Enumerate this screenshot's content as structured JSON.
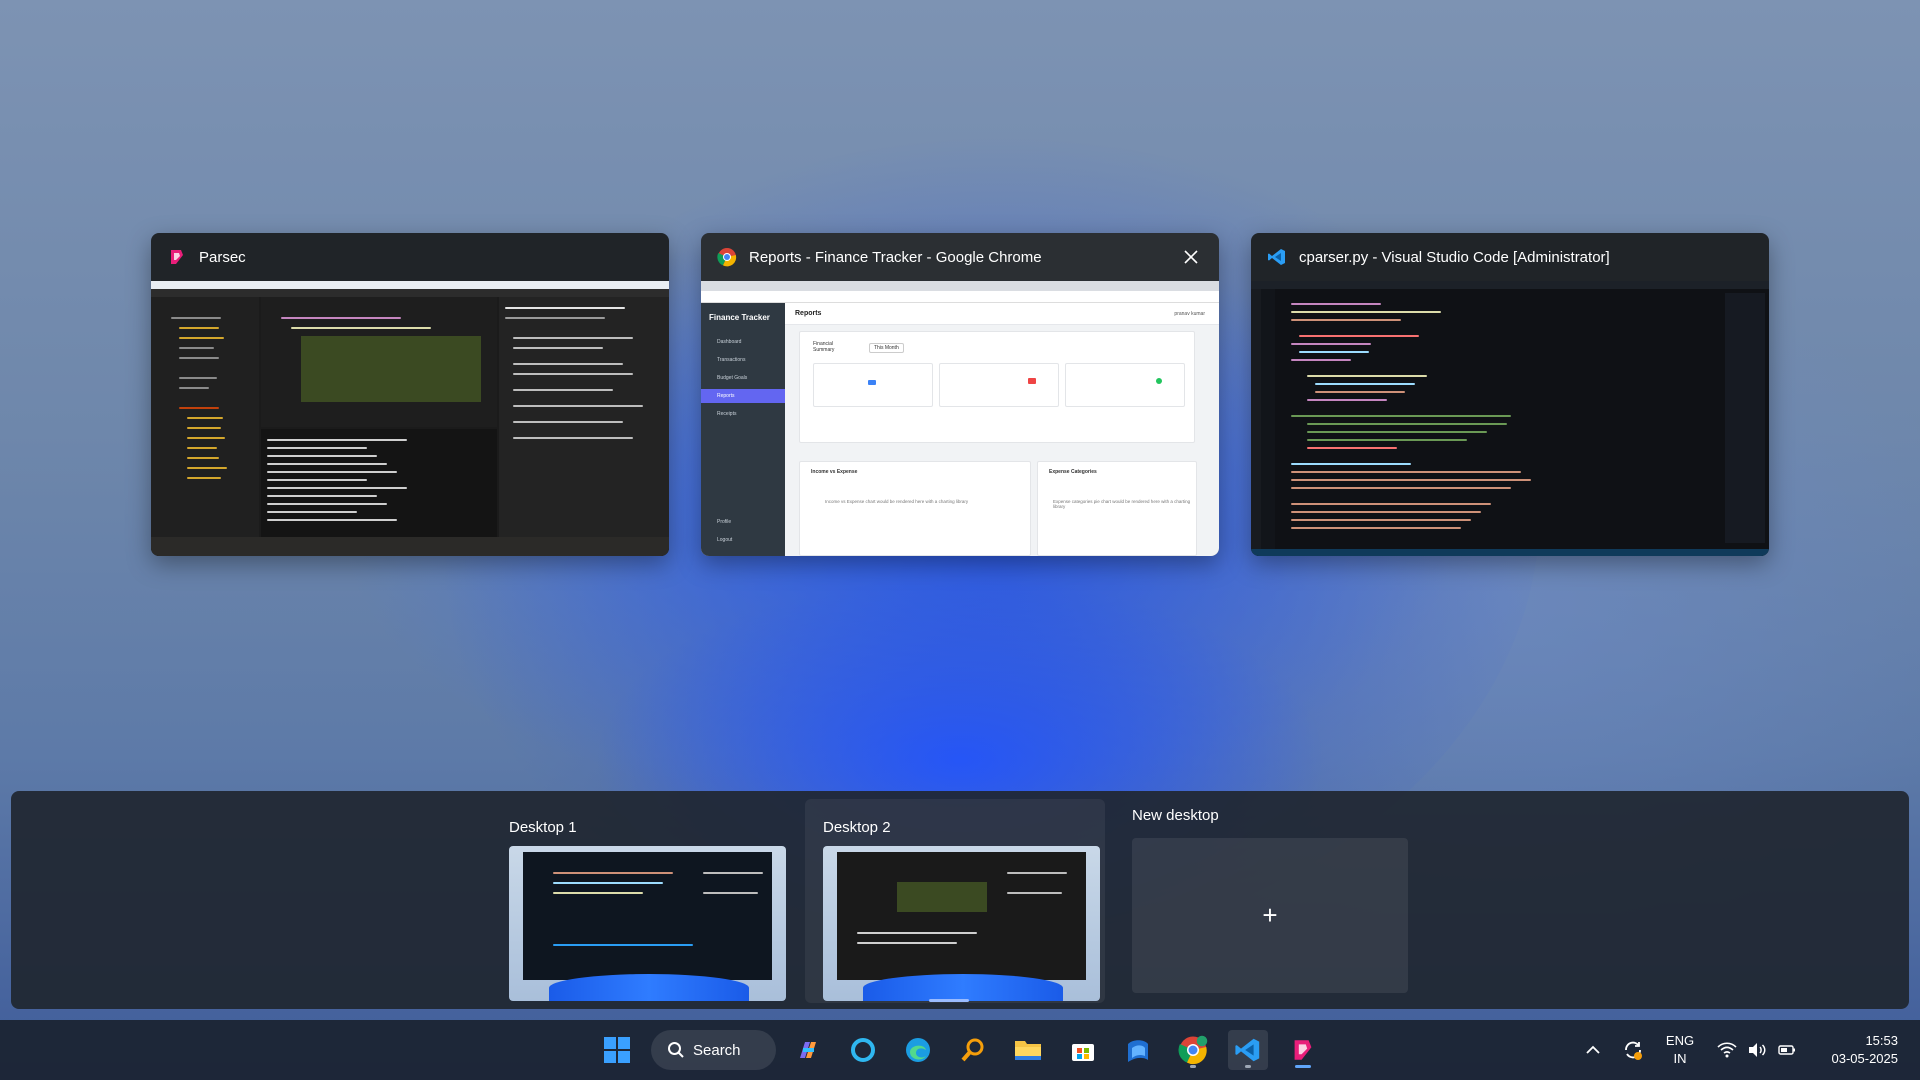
{
  "windows": [
    {
      "title": "Parsec",
      "icon": "parsec-icon"
    },
    {
      "title": "Reports - Finance Tracker - Google Chrome",
      "icon": "chrome-icon"
    },
    {
      "title": "cparser.py - Visual Studio Code [Administrator]",
      "icon": "vscode-icon"
    }
  ],
  "chrome_thumb": {
    "app_title": "Finance Tracker",
    "page_title": "Reports",
    "user": "pranav kumar",
    "nav": [
      "Dashboard",
      "Transactions",
      "Budget Goals",
      "Reports",
      "Receipts"
    ],
    "nav_bottom": [
      "Profile",
      "Logout"
    ],
    "summary_label": "Financial Summary",
    "period": "This Month",
    "card_income": "Income vs Expense",
    "card_categories": "Expense Categories",
    "income_note": "Income vs Expense chart would be rendered here with a charting library",
    "categories_note": "Expense categories pie chart would be rendered here with a charting library"
  },
  "desktops": [
    {
      "label": "Desktop 1"
    },
    {
      "label": "Desktop 2"
    }
  ],
  "new_desktop": {
    "label": "New desktop",
    "plus": "+"
  },
  "taskbar": {
    "search_label": "Search",
    "apps": [
      "start-icon",
      "copilot-icon",
      "cortana-icon",
      "edge-icon",
      "search-tool-icon",
      "file-explorer-icon",
      "store-icon",
      "word-icon",
      "chrome-icon",
      "vscode-icon",
      "parsec-icon"
    ],
    "language": "ENG",
    "region": "IN",
    "time": "15:53",
    "date": "03-05-2025"
  },
  "colors": {
    "accent": "#60a5fa",
    "chrome_nav_selected": "#6366f1",
    "parsec": "#e91e7a",
    "vscode": "#2a9df4"
  }
}
